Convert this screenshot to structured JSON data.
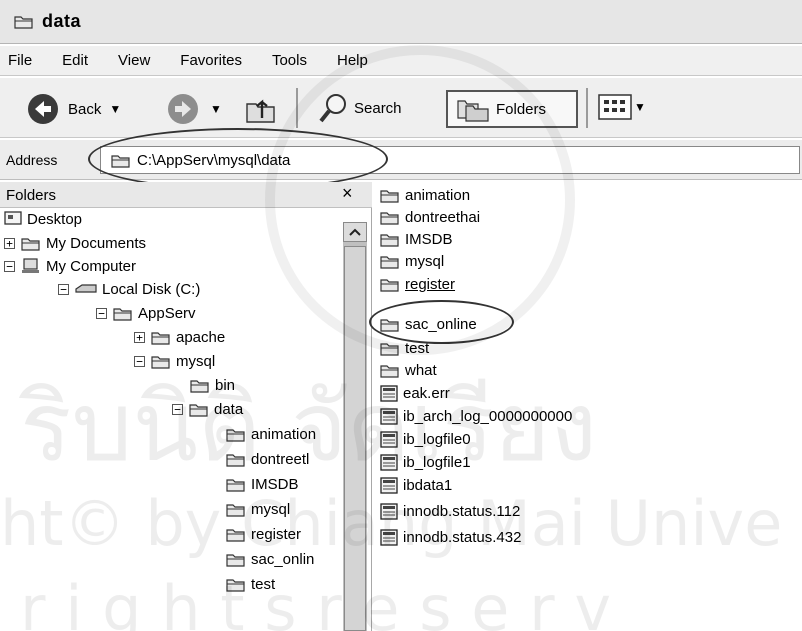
{
  "window": {
    "title": "data"
  },
  "menu": [
    "File",
    "Edit",
    "View",
    "Favorites",
    "Tools",
    "Help"
  ],
  "toolbar": {
    "back_label": "Back",
    "search_label": "Search",
    "folders_label": "Folders"
  },
  "address": {
    "label": "Address",
    "path": "C:\\AppServ\\mysql\\data"
  },
  "folders_pane": {
    "title": "Folders",
    "close_glyph": "×",
    "tree": [
      {
        "label": "Desktop",
        "expander": ""
      },
      {
        "label": "My Documents",
        "expander": "+"
      },
      {
        "label": "My Computer",
        "expander": "−"
      },
      {
        "label": "Local Disk (C:)",
        "expander": "−"
      },
      {
        "label": "AppServ",
        "expander": "−"
      },
      {
        "label": "apache",
        "expander": "+"
      },
      {
        "label": "mysql",
        "expander": "−"
      },
      {
        "label": "bin",
        "expander": ""
      },
      {
        "label": "data",
        "expander": "−"
      },
      {
        "label": "animation",
        "expander": ""
      },
      {
        "label": "dontreetl",
        "expander": ""
      },
      {
        "label": "IMSDB",
        "expander": ""
      },
      {
        "label": "mysql",
        "expander": ""
      },
      {
        "label": "register",
        "expander": ""
      },
      {
        "label": "sac_onlin",
        "expander": ""
      },
      {
        "label": "test",
        "expander": ""
      }
    ]
  },
  "contents": {
    "folders": [
      "animation",
      "dontreethai",
      "IMSDB",
      "mysql",
      "register",
      "sac_online",
      "test",
      "what"
    ],
    "files": [
      "eak.err",
      "ib_arch_log_0000000000",
      "ib_logfile0",
      "ib_logfile1",
      "ibdata1",
      "innodb.status.112",
      "innodb.status.432"
    ]
  },
  "watermark": {
    "line1": "ริบนิติ จัดเรียง",
    "line2": "ht© by Chiang Mai Unive",
    "line3": "r i g h t s   r e s e r v"
  }
}
